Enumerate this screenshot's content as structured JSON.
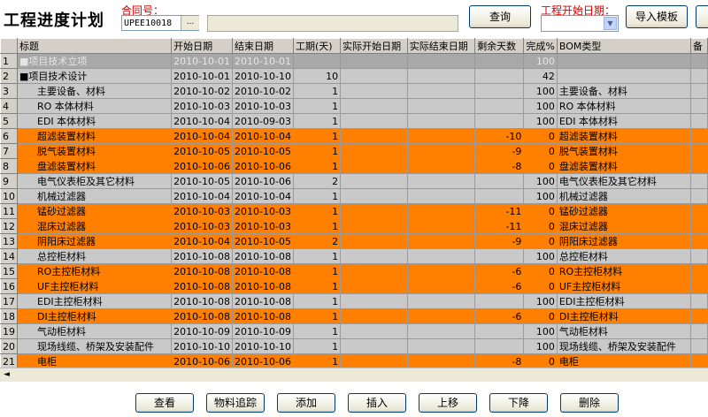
{
  "title": "工程进度计划",
  "contract": {
    "label": "合同号：",
    "value": "UPEE10018",
    "ellipsis": "..."
  },
  "start_date": {
    "label": "工程开始日期：",
    "value": ""
  },
  "buttons": {
    "query": "查询",
    "import_template": "导入模板"
  },
  "columns": [
    "标题",
    "开始日期",
    "结束日期",
    "工期(天)",
    "实际开始日期",
    "实际结束日期",
    "剩余天数",
    "完成%",
    "BOM类型",
    "备"
  ],
  "rows": [
    {
      "n": "1",
      "style": "head",
      "title": "■项目技术立项",
      "start": "2010-10-01",
      "end": "2010-10-01",
      "days": "",
      "as": "",
      "ae": "",
      "remain": "",
      "pct": "100",
      "bom": ""
    },
    {
      "n": "2",
      "style": "gray",
      "title": "■项目技术设计",
      "start": "2010-10-01",
      "end": "2010-10-10",
      "days": "10",
      "as": "",
      "ae": "",
      "remain": "",
      "pct": "42",
      "bom": ""
    },
    {
      "n": "3",
      "style": "gray",
      "title": "主要设备、材料",
      "start": "2010-10-02",
      "end": "2010-10-02",
      "days": "1",
      "as": "",
      "ae": "",
      "remain": "",
      "pct": "100",
      "bom": "主要设备、材料"
    },
    {
      "n": "4",
      "style": "gray",
      "title": "RO 本体材料",
      "start": "2010-10-03",
      "end": "2010-10-03",
      "days": "1",
      "as": "",
      "ae": "",
      "remain": "",
      "pct": "100",
      "bom": "RO 本体材料"
    },
    {
      "n": "5",
      "style": "gray",
      "title": "EDI 本体材料",
      "start": "2010-10-04",
      "end": "2010-09-03",
      "days": "1",
      "as": "",
      "ae": "",
      "remain": "",
      "pct": "100",
      "bom": "EDI 本体材料"
    },
    {
      "n": "6",
      "style": "orange",
      "title": "超滤装置材料",
      "start": "2010-10-04",
      "end": "2010-10-04",
      "days": "1",
      "as": "",
      "ae": "",
      "remain": "-10",
      "pct": "0",
      "bom": "超滤装置材料"
    },
    {
      "n": "7",
      "style": "orange",
      "title": "脱气装置材料",
      "start": "2010-10-05",
      "end": "2010-10-05",
      "days": "1",
      "as": "",
      "ae": "",
      "remain": "-9",
      "pct": "0",
      "bom": "脱气装置材料"
    },
    {
      "n": "8",
      "style": "orange",
      "title": "盘滤装置材料",
      "start": "2010-10-06",
      "end": "2010-10-06",
      "days": "1",
      "as": "",
      "ae": "",
      "remain": "-8",
      "pct": "0",
      "bom": "盘滤装置材料"
    },
    {
      "n": "9",
      "style": "gray",
      "title": "电气仪表柜及其它材料",
      "start": "2010-10-05",
      "end": "2010-10-06",
      "days": "2",
      "as": "",
      "ae": "",
      "remain": "",
      "pct": "100",
      "bom": "电气仪表柜及其它材料"
    },
    {
      "n": "10",
      "style": "gray",
      "title": "机械过滤器",
      "start": "2010-10-04",
      "end": "2010-10-04",
      "days": "1",
      "as": "",
      "ae": "",
      "remain": "",
      "pct": "100",
      "bom": "机械过滤器"
    },
    {
      "n": "11",
      "style": "orange",
      "title": "锰砂过滤器",
      "start": "2010-10-03",
      "end": "2010-10-03",
      "days": "1",
      "as": "",
      "ae": "",
      "remain": "-11",
      "pct": "0",
      "bom": "锰砂过滤器"
    },
    {
      "n": "12",
      "style": "orange",
      "title": "混床过滤器",
      "start": "2010-10-03",
      "end": "2010-10-03",
      "days": "1",
      "as": "",
      "ae": "",
      "remain": "-11",
      "pct": "0",
      "bom": "混床过滤器"
    },
    {
      "n": "13",
      "style": "orange",
      "title": "阴阳床过滤器",
      "start": "2010-10-04",
      "end": "2010-10-05",
      "days": "2",
      "as": "",
      "ae": "",
      "remain": "-9",
      "pct": "0",
      "bom": "阴阳床过滤器"
    },
    {
      "n": "14",
      "style": "gray",
      "title": "总控柜材料",
      "start": "2010-10-08",
      "end": "2010-10-08",
      "days": "1",
      "as": "",
      "ae": "",
      "remain": "",
      "pct": "100",
      "bom": "总控柜材料"
    },
    {
      "n": "15",
      "style": "orange",
      "title": "RO主控柜材料",
      "start": "2010-10-08",
      "end": "2010-10-08",
      "days": "1",
      "as": "",
      "ae": "",
      "remain": "-6",
      "pct": "0",
      "bom": "RO主控柜材料"
    },
    {
      "n": "16",
      "style": "orange",
      "title": "UF主控柜材料",
      "start": "2010-10-08",
      "end": "2010-10-08",
      "days": "1",
      "as": "",
      "ae": "",
      "remain": "-6",
      "pct": "0",
      "bom": "UF主控柜材料"
    },
    {
      "n": "17",
      "style": "gray",
      "title": "EDI主控柜材料",
      "start": "2010-10-08",
      "end": "2010-10-08",
      "days": "1",
      "as": "",
      "ae": "",
      "remain": "",
      "pct": "100",
      "bom": "EDI主控柜材料"
    },
    {
      "n": "18",
      "style": "orange",
      "title": "DI主控柜材料",
      "start": "2010-10-08",
      "end": "2010-10-08",
      "days": "1",
      "as": "",
      "ae": "",
      "remain": "-6",
      "pct": "0",
      "bom": "DI主控柜材料"
    },
    {
      "n": "19",
      "style": "gray",
      "title": "气动柜材料",
      "start": "2010-10-09",
      "end": "2010-10-09",
      "days": "1",
      "as": "",
      "ae": "",
      "remain": "",
      "pct": "100",
      "bom": "气动柜材料"
    },
    {
      "n": "20",
      "style": "gray",
      "title": "现场线缆、桥架及安装配件",
      "start": "2010-10-10",
      "end": "2010-10-10",
      "days": "1",
      "as": "",
      "ae": "",
      "remain": "",
      "pct": "100",
      "bom": "现场线缆、桥架及安装配件"
    },
    {
      "n": "21",
      "style": "orange",
      "title": "电柜",
      "start": "2010-10-06",
      "end": "2010-10-06",
      "days": "1",
      "as": "",
      "ae": "",
      "remain": "-8",
      "pct": "0",
      "bom": "电柜"
    }
  ],
  "bottom_buttons": [
    "查看",
    "物料追踪",
    "添加",
    "插入",
    "上移",
    "下降",
    "删除"
  ],
  "colors": {
    "orange": "#ff8000",
    "gray": "#c9c9c9",
    "label_red": "#d40000"
  },
  "icons": {
    "scroll_left": "◄",
    "dropdown": "▼"
  }
}
